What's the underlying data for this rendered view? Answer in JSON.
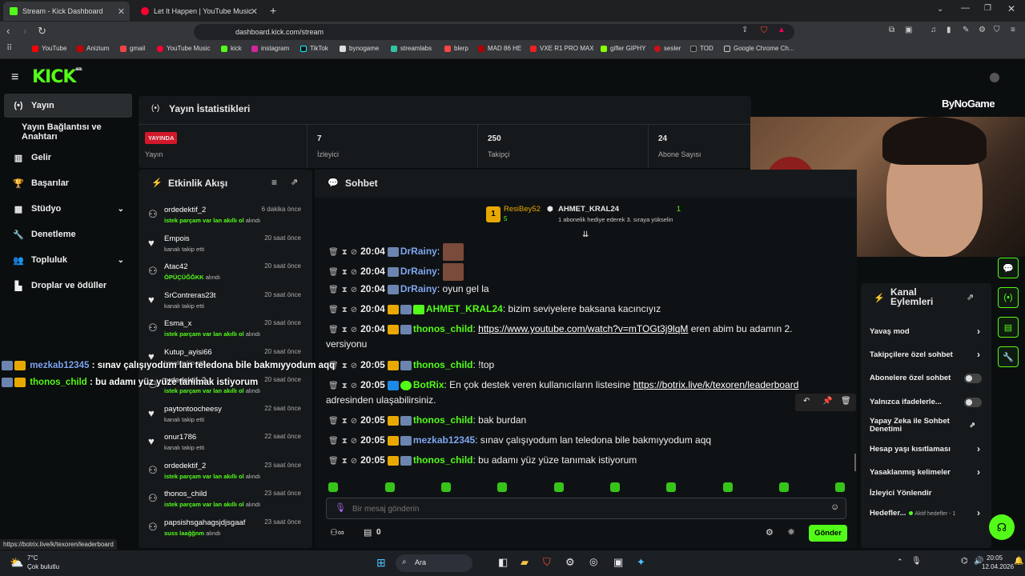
{
  "browser": {
    "tabs": [
      {
        "title": "Stream - Kick Dashboard",
        "active": true
      },
      {
        "title": "Let It Happen | YouTube Music",
        "active": false
      }
    ],
    "new_tab": "+",
    "url": "dashboard.kick.com/stream",
    "bookmarks": [
      "YouTube",
      "Anizium",
      "gmail",
      "YouTube Music",
      "kick",
      "instagram",
      "TikTok",
      "bynogame",
      "streamlabs",
      "blerp",
      "MAD 86 HE",
      "VXE R1 PRO MAX",
      "gifler GIPHY",
      "sesler",
      "TOD",
      "Google Chrome Ch..."
    ],
    "status_url": "https://botrix.live/k/texoren/leaderboard"
  },
  "kick": {
    "logo": "KICK",
    "logo_sup": "BETA",
    "sidebar": [
      {
        "label": "Yayın",
        "icon": "(•)",
        "active": true
      },
      {
        "label": "Yayın Bağlantısı ve Anahtarı",
        "icon": "",
        "sub": true
      },
      {
        "label": "Gelir",
        "icon": "▥"
      },
      {
        "label": "Başarılar",
        "icon": "🏆"
      },
      {
        "label": "Stüdyo",
        "icon": "▦",
        "chev": "⌄"
      },
      {
        "label": "Denetleme",
        "icon": "🔧"
      },
      {
        "label": "Topluluk",
        "icon": "👥",
        "chev": "⌄"
      },
      {
        "label": "Droplar ve ödüller",
        "icon": "▙"
      }
    ],
    "stats": {
      "title": "Yayın İstatistikleri",
      "live_badge": "YAYINDA",
      "live_label": "Yayın",
      "viewers_value": "7",
      "viewers_label": "İzleyici",
      "followers_value": "250",
      "followers_label": "Takipçi",
      "subs_value": "24",
      "subs_label": "Abone Sayısı"
    },
    "activity": {
      "title": "Etkinlik Akışı",
      "events": [
        {
          "name": "ordedektif_2",
          "time": "6 dakika önce",
          "detail_hl": "istek parçam var lan akıllı ol",
          "detail": "alındı",
          "type": "redeem"
        },
        {
          "name": "Empois",
          "time": "20 saat önce",
          "detail_hl": "",
          "detail": "kanalı takip etti",
          "type": "follow"
        },
        {
          "name": "Atac42",
          "time": "20 saat önce",
          "detail_hl": "ÖPÜÇÜĞĞKK",
          "detail": "alındı",
          "type": "redeem"
        },
        {
          "name": "SrContreras23t",
          "time": "20 saat önce",
          "detail_hl": "",
          "detail": "kanalı takip etti",
          "type": "follow"
        },
        {
          "name": "Esma_x",
          "time": "20 saat önce",
          "detail_hl": "istek parçam var lan akıllı ol",
          "detail": "alındı",
          "type": "redeem"
        },
        {
          "name": "Kutup_ayisi66",
          "time": "20 saat önce",
          "detail_hl": "",
          "detail": "kanalı takip etti",
          "type": "follow"
        },
        {
          "name": "ordedektif_2",
          "time": "20 saat önce",
          "detail_hl": "istek parçam var lan akıllı ol",
          "detail": "alındı",
          "type": "redeem"
        },
        {
          "name": "paytontoocheesy",
          "time": "22 saat önce",
          "detail_hl": "",
          "detail": "kanalı takip etti",
          "type": "follow"
        },
        {
          "name": "onur1786",
          "time": "22 saat önce",
          "detail_hl": "",
          "detail": "kanalı takip etti",
          "type": "follow"
        },
        {
          "name": "ordedektif_2",
          "time": "23 saat önce",
          "detail_hl": "istek parçam var lan akıllı ol",
          "detail": "alındı",
          "type": "redeem"
        },
        {
          "name": "thonos_child",
          "time": "23 saat önce",
          "detail_hl": "istek parçam var lan akıllı ol",
          "detail": "alındı",
          "type": "redeem"
        },
        {
          "name": "papsishsgahagsjdjsgaaf",
          "time": "23 saat önce",
          "detail_hl": "suss laağğnm",
          "detail": "alındı",
          "type": "redeem"
        }
      ]
    },
    "chat": {
      "title": "Sohbet",
      "pinned_rank": "1",
      "pinned_user": "ResiBey52",
      "pinned_count": "5",
      "pinned_gifter": "AHMET_KRAL24",
      "pinned_gift_count": "1",
      "pinned_text": "1 abonelik hediye ederek 3. sıraya yükselin",
      "messages": [
        {
          "time": "20:04",
          "user": "DrRainy",
          "text": "",
          "color": "#7ea6f0"
        },
        {
          "time": "20:04",
          "user": "DrRainy",
          "text": "",
          "color": "#7ea6f0"
        },
        {
          "time": "20:04",
          "user": "DrRainy",
          "text": "oyun gel la",
          "color": "#7ea6f0"
        },
        {
          "time": "20:04",
          "user": "AHMET_KRAL24",
          "text": "bizim seviyelere baksana kacıncıyız",
          "color": "#53fc18"
        },
        {
          "time": "20:04",
          "user": "thonos_child",
          "link": "https://www.youtube.com/watch?v=mTOGt3j9lqM",
          "text": " eren abim bu adamın 2.",
          "text2": "versiyonu",
          "color": "#53fc18"
        },
        {
          "time": "20:05",
          "user": "thonos_child",
          "text": "!top",
          "color": "#53fc18"
        },
        {
          "time": "20:05",
          "user": "BotRix",
          "text": "En çok destek veren kullanıcıların listesine ",
          "link": "https://botrix.live/k/texoren/leaderboard",
          "text2": "adresinden ulaşabilirsiniz.",
          "color": "#53fc18"
        },
        {
          "time": "20:05",
          "user": "thonos_child",
          "text": "bak burdan",
          "color": "#53fc18"
        },
        {
          "time": "20:05",
          "user": "mezkab12345",
          "text": "sınav çalışıyodum lan teledona bile bakmıyyodum aqq",
          "color": "#7ea6f0"
        },
        {
          "time": "20:05",
          "user": "thonos_child",
          "text": "bu adamı yüz yüze tanımak istiyorum",
          "color": "#53fc18"
        }
      ],
      "input_placeholder": "Bir mesaj gönderin",
      "points": "0",
      "send": "Gönder"
    },
    "channel_actions": {
      "title": "Kanal Eylemleri",
      "items": [
        {
          "label": "Yavaş mod",
          "ctrl": "arrow"
        },
        {
          "label": "Takipçilere özel sohbet",
          "ctrl": "arrow"
        },
        {
          "label": "Abonelere özel sohbet",
          "ctrl": "toggle"
        },
        {
          "label": "Yalnızca ifadelerle...",
          "ctrl": "toggle"
        },
        {
          "label": "Yapay Zeka ile Sohbet Denetimi",
          "ctrl": "ext"
        },
        {
          "label": "Hesap yaşı kısıtlaması",
          "ctrl": "arrow"
        },
        {
          "label": "Yasaklanmış kelimeler",
          "ctrl": "arrow"
        },
        {
          "label": "İzleyici Yönlendir",
          "ctrl": "none"
        },
        {
          "label": "Hedefler...",
          "ctrl": "arrow",
          "extra": "Aktif hedefler - 1"
        }
      ]
    },
    "overlay": {
      "brand": "ByNoGame",
      "lines": [
        {
          "user": "mezkab12345",
          "text": ": sınav çalışıyodum lan teledona bile bakmıyyodum aqq"
        },
        {
          "user": "thonos_child",
          "text": ": bu adamı yüz yüze tanımak istiyorum"
        }
      ]
    }
  },
  "taskbar": {
    "weather_temp": "7°C",
    "weather_desc": "Çok bulutlu",
    "search": "Ara",
    "time": "20:05",
    "date": "12.04.2026"
  }
}
